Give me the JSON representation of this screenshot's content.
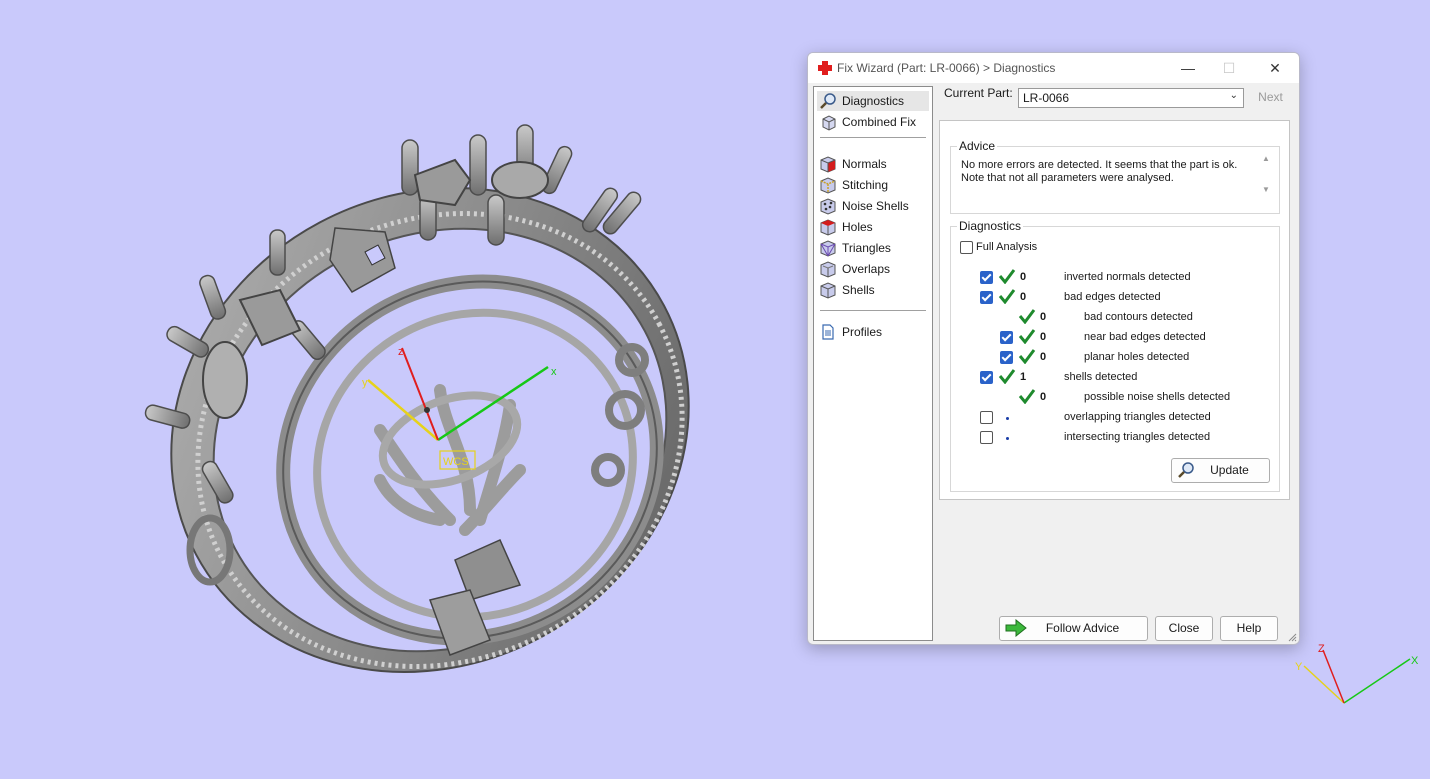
{
  "dialog": {
    "title": "Fix Wizard (Part: LR-0066) > Diagnostics",
    "minimize": "—",
    "maximize": "☐",
    "close": "✕"
  },
  "nav": {
    "items": [
      {
        "label": "Diagnostics",
        "icon": "magnifier-icon",
        "selected": true
      },
      {
        "label": "Combined Fix",
        "icon": "cube-stack-icon"
      },
      {
        "label": "Normals",
        "icon": "normals-cube-icon"
      },
      {
        "label": "Stitching",
        "icon": "stitching-cube-icon"
      },
      {
        "label": "Noise Shells",
        "icon": "noise-shells-icon"
      },
      {
        "label": "Holes",
        "icon": "holes-cube-icon"
      },
      {
        "label": "Triangles",
        "icon": "triangles-cube-icon"
      },
      {
        "label": "Overlaps",
        "icon": "overlaps-cube-icon"
      },
      {
        "label": "Shells",
        "icon": "shells-cube-icon"
      },
      {
        "label": "Profiles",
        "icon": "document-icon"
      }
    ]
  },
  "current_part": {
    "label": "Current Part:",
    "value": "LR-0066",
    "next_label": "Next"
  },
  "advice": {
    "title": "Advice",
    "line1": "No more errors are detected. It seems that the part is ok.",
    "line2": "Note that not all parameters were analysed."
  },
  "diagnostics": {
    "title": "Diagnostics",
    "full_analysis_label": "Full Analysis",
    "full_analysis_checked": false,
    "rows": [
      {
        "checkbox": true,
        "checked": true,
        "status": "ok",
        "count": "0",
        "label": "inverted normals detected"
      },
      {
        "checkbox": true,
        "checked": true,
        "status": "ok",
        "count": "0",
        "label": "bad edges detected"
      },
      {
        "checkbox": false,
        "checked": false,
        "status": "ok",
        "count": "0",
        "label": "bad contours detected"
      },
      {
        "checkbox": true,
        "checked": true,
        "status": "ok",
        "count": "0",
        "label": "near bad edges detected"
      },
      {
        "checkbox": true,
        "checked": true,
        "status": "ok",
        "count": "0",
        "label": "planar holes detected"
      },
      {
        "checkbox": true,
        "checked": true,
        "status": "ok",
        "count": "1",
        "label": "shells detected"
      },
      {
        "checkbox": false,
        "checked": false,
        "status": "ok",
        "count": "0",
        "label": "possible noise shells detected"
      },
      {
        "checkbox": true,
        "checked": false,
        "status": "unknown",
        "count": "",
        "label": "overlapping triangles detected"
      },
      {
        "checkbox": true,
        "checked": false,
        "status": "unknown",
        "count": "",
        "label": "intersecting triangles detected"
      }
    ],
    "update_label": "Update"
  },
  "buttons": {
    "follow_advice": "Follow Advice",
    "close": "Close",
    "help": "Help"
  },
  "viewport": {
    "wcs_label": "WCS",
    "axis_x": "x",
    "axis_y": "y",
    "axis_z": "z",
    "corner_x": "X",
    "corner_y": "Y",
    "corner_z": "Z"
  },
  "colors": {
    "background": "#c9c9fb",
    "check_green": "#1f8a2e",
    "checkbox_blue": "#2a62c9",
    "axis_x": "#16c816",
    "axis_y": "#e6d21a",
    "axis_z": "#e01e1e"
  }
}
